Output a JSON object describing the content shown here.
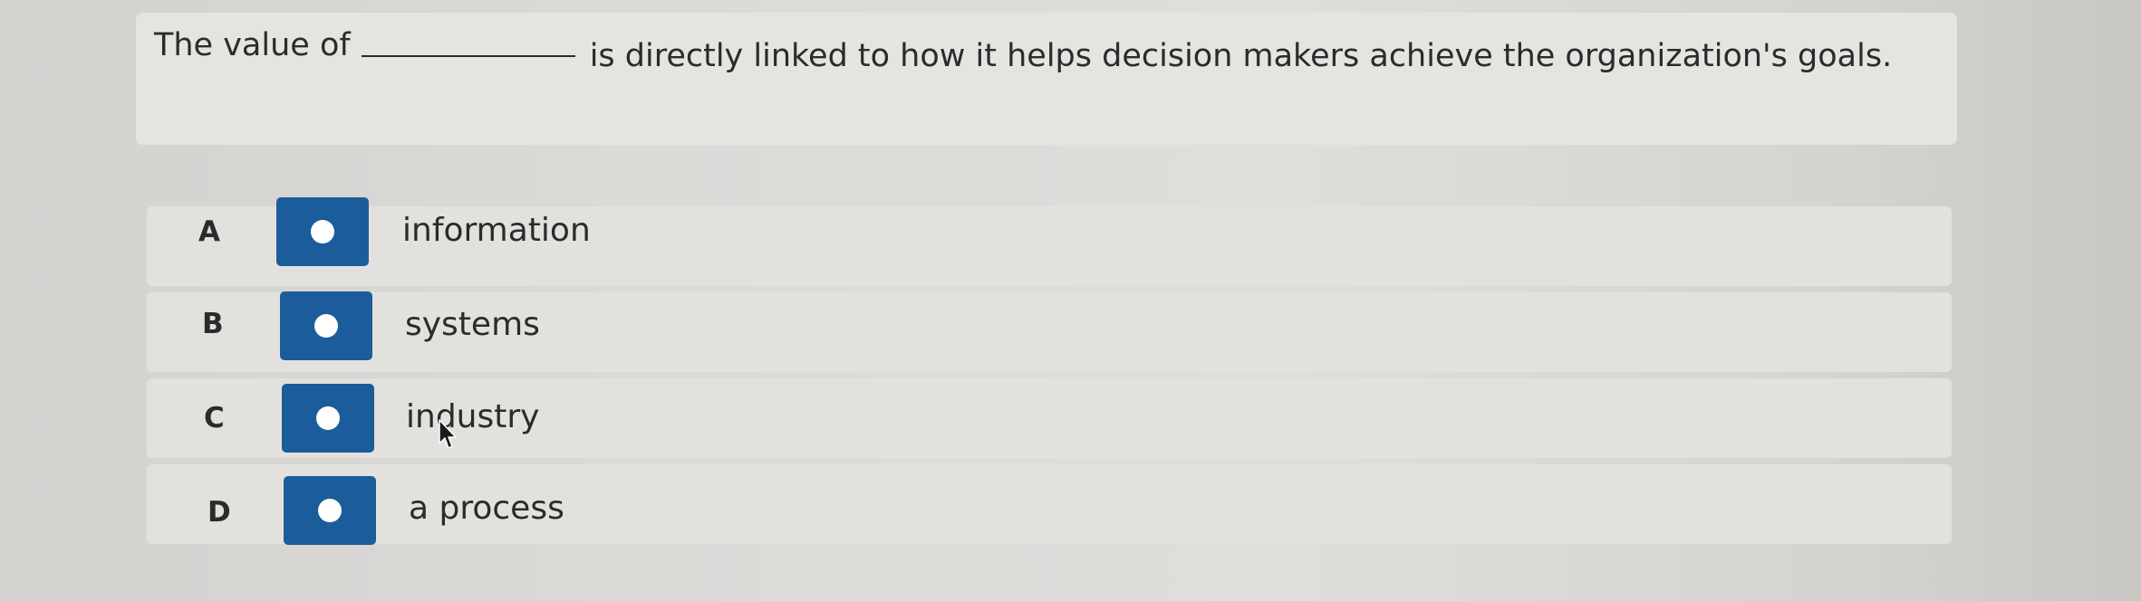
{
  "question": {
    "part1": "The value of",
    "part2": "is directly linked to how it helps decision makers achieve the organization's goals."
  },
  "options": [
    {
      "letter": "A",
      "text": "information"
    },
    {
      "letter": "B",
      "text": "systems"
    },
    {
      "letter": "C",
      "text": "industry"
    },
    {
      "letter": "D",
      "text": "a process"
    }
  ],
  "colors": {
    "accent": "#1b5d9a",
    "background": "#dcdad7",
    "row": "#e3e1de"
  },
  "icons": {
    "radio": "radio-button-icon",
    "cursor": "mouse-pointer-icon"
  }
}
